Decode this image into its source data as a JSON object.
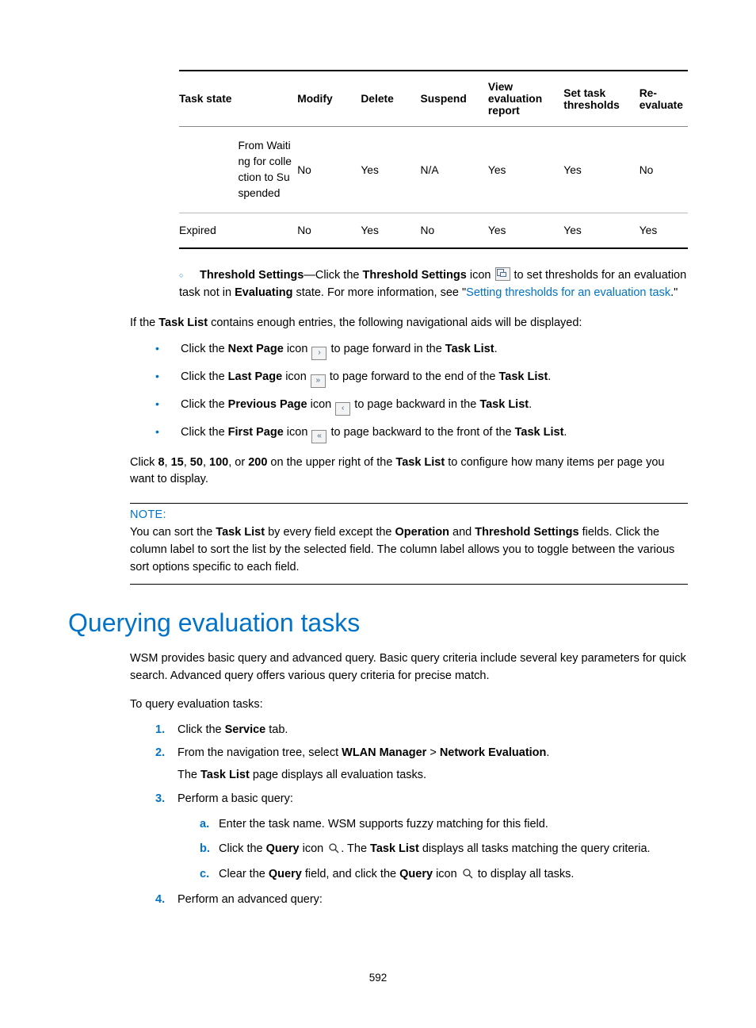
{
  "table": {
    "headers": [
      "Task state",
      "Modify",
      "Delete",
      "Suspend",
      "View evaluation report",
      "Set task thresholds",
      "Re-evaluate"
    ],
    "rows": [
      {
        "state": "",
        "substate": "From Waiting for collection to Suspended",
        "modify": "No",
        "delete": "Yes",
        "suspend": "N/A",
        "view": "Yes",
        "set": "Yes",
        "re": "No"
      },
      {
        "state": "Expired",
        "substate": "",
        "modify": "No",
        "delete": "Yes",
        "suspend": "No",
        "view": "Yes",
        "set": "Yes",
        "re": "Yes"
      }
    ]
  },
  "threshold": {
    "lead_bold": "Threshold Settings",
    "dash": "—Click the ",
    "mid_bold": "Threshold Settings",
    "mid_plain": " icon ",
    "after_icon": " to set thresholds for an evaluation task not in ",
    "eval_bold": "Evaluating",
    "after_eval": " state. For more information, see \"",
    "link_text": "Setting thresholds for an evaluation task",
    "after_link": ".\""
  },
  "task_list_intro": {
    "p1": "If the ",
    "tl": "Task List",
    "p2": " contains enough entries, the following navigational aids will be displayed:"
  },
  "nav": {
    "next": {
      "pre": "Click the ",
      "bold": "Next Page",
      "mid": " icon ",
      "glyph": "›",
      "post_a": " to page forward in the ",
      "tl": "Task List",
      "end": "."
    },
    "last": {
      "pre": "Click the ",
      "bold": "Last Page",
      "mid": " icon ",
      "glyph": "»",
      "post_a": " to page forward to the end of the ",
      "tl": "Task List",
      "end": "."
    },
    "prev": {
      "pre": "Click the ",
      "bold": "Previous Page",
      "mid": " icon ",
      "glyph": "‹",
      "post_a": " to page backward in the ",
      "tl": "Task List",
      "end": "."
    },
    "first": {
      "pre": "Click the ",
      "bold": "First Page",
      "mid": " icon ",
      "glyph": "«",
      "post_a": " to page backward to the front of the ",
      "tl": "Task List",
      "end": "."
    }
  },
  "items_per_page": {
    "pre": "Click ",
    "n1": "8",
    "c1": ", ",
    "n2": "15",
    "c2": ", ",
    "n3": "50",
    "c3": ", ",
    "n4": "100",
    "c4": ", or ",
    "n5": "200",
    "mid": " on the upper right of the ",
    "tl": "Task List",
    "post": " to configure how many items per page you want to display."
  },
  "note": {
    "label": "NOTE:",
    "p1": "You can sort the ",
    "tl": "Task List",
    "p2": " by every field except the ",
    "op": "Operation",
    "p3": " and ",
    "ts": "Threshold Settings",
    "p4": " fields. Click the column label to sort the list by the selected field. The column label allows you to toggle between the various sort options specific to each field."
  },
  "heading": "Querying evaluation tasks",
  "query_intro": "WSM provides basic query and advanced query. Basic query criteria include several key parameters for quick search. Advanced query offers various query criteria for precise match.",
  "query_lead": "To query evaluation tasks:",
  "steps": {
    "s1": {
      "num": "1.",
      "pre": "Click the ",
      "bold": "Service",
      "post": " tab."
    },
    "s2": {
      "num": "2.",
      "pre": "From the navigation tree, select ",
      "b1": "WLAN Manager",
      "gt": " > ",
      "b2": "Network Evaluation",
      "post": ".",
      "sub_pre": "The ",
      "sub_b": "Task List",
      "sub_post": " page displays all evaluation tasks."
    },
    "s3": {
      "num": "3.",
      "text": "Perform a basic query:",
      "a": {
        "let": "a.",
        "text": "Enter the task name. WSM supports fuzzy matching for this field."
      },
      "b": {
        "let": "b.",
        "pre": "Click the ",
        "q": "Query",
        "mid": " icon ",
        "post_a": ". The ",
        "tl": "Task List",
        "post_b": " displays all tasks matching the query criteria."
      },
      "c": {
        "let": "c.",
        "pre": "Clear the ",
        "q1": "Query",
        "mid1": " field, and click the ",
        "q2": "Query",
        "mid2": " icon ",
        "post": " to display all tasks."
      }
    },
    "s4": {
      "num": "4.",
      "text": "Perform an advanced query:"
    }
  },
  "page_number": "592"
}
